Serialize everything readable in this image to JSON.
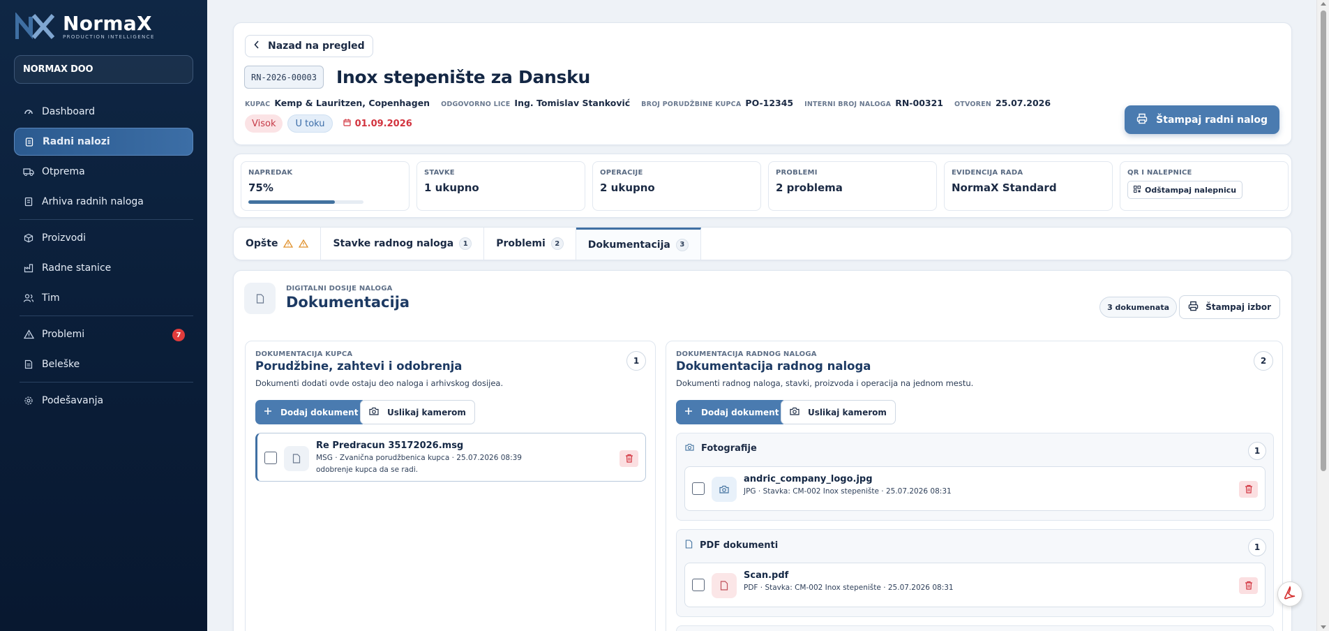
{
  "brand": {
    "name": "NormaX",
    "tagline": "PRODUCTION INTELLIGENCE"
  },
  "company": "NORMAX DOO",
  "sidebar": {
    "items": [
      {
        "label": "Dashboard",
        "icon": "dashboard-icon"
      },
      {
        "label": "Radni nalozi",
        "icon": "clipboard-icon",
        "active": true
      },
      {
        "label": "Otprema",
        "icon": "truck-icon"
      },
      {
        "label": "Arhiva radnih naloga",
        "icon": "archive-icon"
      },
      {
        "label": "Proizvodi",
        "icon": "box-icon"
      },
      {
        "label": "Radne stanice",
        "icon": "factory-icon"
      },
      {
        "label": "Tim",
        "icon": "users-icon"
      },
      {
        "label": "Problemi",
        "icon": "warning-icon",
        "badge": "7"
      },
      {
        "label": "Beleške",
        "icon": "note-icon"
      },
      {
        "label": "Podešavanja",
        "icon": "gear-icon"
      }
    ]
  },
  "header": {
    "back_label": "Nazad na pregled",
    "code": "RN-2026-00003",
    "title": "Inox stepenište za Dansku",
    "meta": [
      {
        "label": "KUPAC",
        "value": "Kemp & Lauritzen, Copenhagen"
      },
      {
        "label": "ODGOVORNO LICE",
        "value": "Ing. Tomislav Stanković"
      },
      {
        "label": "BROJ PORUDŽBINE KUPCA",
        "value": "PO-12345"
      },
      {
        "label": "INTERNI BROJ NALOGA",
        "value": "RN-00321"
      },
      {
        "label": "OTVOREN",
        "value": "25.07.2026"
      }
    ],
    "priority": "Visok",
    "status": "U toku",
    "due_date": "01.09.2026",
    "print_label": "Štampaj radni nalog"
  },
  "stats": [
    {
      "label": "NAPREDAK",
      "value": "75%",
      "progress": 0.75
    },
    {
      "label": "STAVKE",
      "value": "1 ukupno"
    },
    {
      "label": "OPERACIJE",
      "value": "2 ukupno"
    },
    {
      "label": "PROBLEMI",
      "value": "2 problema"
    },
    {
      "label": "EVIDENCIJA RADA",
      "value": "NormaX Standard"
    },
    {
      "label": "QR I NALEPNICE",
      "button": "Odštampaj nalepnicu"
    }
  ],
  "tabs": [
    {
      "label": "Opšte"
    },
    {
      "label": "Stavke radnog naloga",
      "count": "1"
    },
    {
      "label": "Problemi",
      "count": "2"
    },
    {
      "label": "Dokumentacija",
      "count": "3",
      "active": true
    }
  ],
  "docs": {
    "overline": "DIGITALNI DOSIJE NALOGA",
    "title": "Dokumentacija",
    "count_label": "3 dokumenata",
    "print_label": "Štampaj izbor",
    "customer": {
      "overline": "DOKUMENTACIJA KUPCA",
      "title": "Porudžbine, zahtevi i odobrenja",
      "subtitle": "Dokumenti dodati ovde ostaju deo naloga i arhivskog dosijea.",
      "count": "1",
      "add_label": "Dodaj dokument",
      "camera_label": "Uslikaj kamerom",
      "files": [
        {
          "name": "Re Predracun 35172026.msg",
          "meta": "MSG · Zvanična porudžbenica kupca · 25.07.2026 08:39",
          "note": "odobrenje kupca da se radi."
        }
      ]
    },
    "order": {
      "overline": "DOKUMENTACIJA RADNOG NALOGA",
      "title": "Dokumentacija radnog naloga",
      "subtitle": "Dokumenti radnog naloga, stavki, proizvoda i operacija na jednom mestu.",
      "count": "2",
      "add_label": "Dodaj dokument",
      "camera_label": "Uslikaj kamerom",
      "groups": [
        {
          "title": "Fotografije",
          "count": "1",
          "file": {
            "name": "andric_company_logo.jpg",
            "meta": "JPG · Stavka: CM-002 Inox stepenište · 25.07.2026 08:31"
          }
        },
        {
          "title": "PDF dokumenti",
          "count": "1",
          "file": {
            "name": "Scan.pdf",
            "meta": "PDF · Stavka: CM-002 Inox stepenište · 25.07.2026 08:31"
          }
        }
      ]
    }
  },
  "colors": {
    "accent": "#4a7bb0",
    "sidebar": "#0f2745",
    "danger": "#d2343f"
  }
}
